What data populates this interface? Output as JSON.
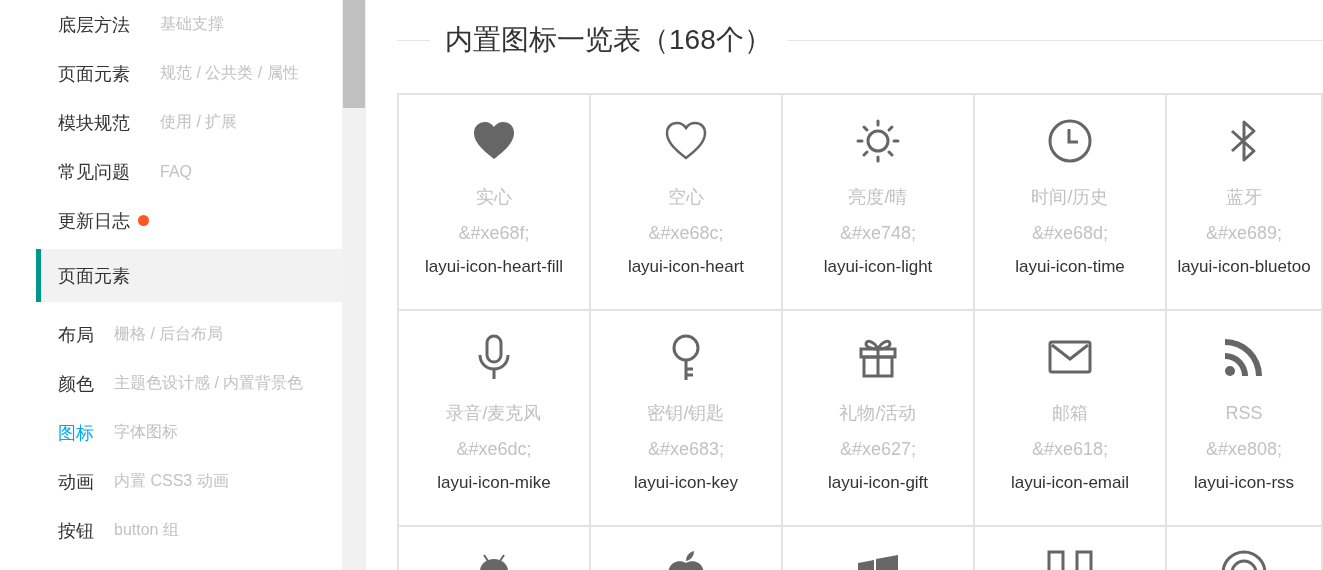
{
  "sidebar": {
    "groups": [
      {
        "items": [
          {
            "title": "底层方法",
            "desc": "基础支撑",
            "selected": false,
            "dot": false
          },
          {
            "title": "页面元素",
            "desc": "规范 / 公共类 / 属性",
            "selected": false,
            "dot": false
          },
          {
            "title": "模块规范",
            "desc": "使用 / 扩展",
            "selected": false,
            "dot": false
          },
          {
            "title": "常见问题",
            "desc": "FAQ",
            "selected": false,
            "dot": false
          },
          {
            "title": "更新日志",
            "selected": false,
            "dot": true
          }
        ]
      },
      {
        "header": "页面元素",
        "items": [
          {
            "title": "布局",
            "desc": "栅格 / 后台布局",
            "selected": false,
            "dot": false
          },
          {
            "title": "颜色",
            "desc": "主题色设计感 / 内置背景色",
            "selected": false,
            "dot": false
          },
          {
            "title": "图标",
            "desc": "字体图标",
            "selected": true,
            "dot": false
          },
          {
            "title": "动画",
            "desc": "内置 CSS3 动画",
            "selected": false,
            "dot": false
          },
          {
            "title": "按钮",
            "desc": "button 组",
            "selected": false,
            "dot": false
          }
        ]
      }
    ]
  },
  "content": {
    "title": "内置图标一览表（168个）",
    "icons": [
      {
        "kind": "heart-fill",
        "name": "实心",
        "code": "&#xe68f;",
        "class": "layui-icon-heart-fill"
      },
      {
        "kind": "heart",
        "name": "空心",
        "code": "&#xe68c;",
        "class": "layui-icon-heart"
      },
      {
        "kind": "sun",
        "name": "亮度/晴",
        "code": "&#xe748;",
        "class": "layui-icon-light"
      },
      {
        "kind": "clock",
        "name": "时间/历史",
        "code": "&#xe68d;",
        "class": "layui-icon-time"
      },
      {
        "kind": "bluetooth",
        "name": "蓝牙",
        "code": "&#xe689;",
        "class": "layui-icon-bluetoo"
      },
      {
        "kind": "mic",
        "name": "录音/麦克风",
        "code": "&#xe6dc;",
        "class": "layui-icon-mike"
      },
      {
        "kind": "key",
        "name": "密钥/钥匙",
        "code": "&#xe683;",
        "class": "layui-icon-key"
      },
      {
        "kind": "gift",
        "name": "礼物/活动",
        "code": "&#xe627;",
        "class": "layui-icon-gift"
      },
      {
        "kind": "mail",
        "name": "邮箱",
        "code": "&#xe618;",
        "class": "layui-icon-email"
      },
      {
        "kind": "rss",
        "name": "RSS",
        "code": "&#xe808;",
        "class": "layui-icon-rss"
      },
      {
        "kind": "android"
      },
      {
        "kind": "apple"
      },
      {
        "kind": "windows"
      },
      {
        "kind": "blocks"
      },
      {
        "kind": "ring"
      }
    ]
  }
}
